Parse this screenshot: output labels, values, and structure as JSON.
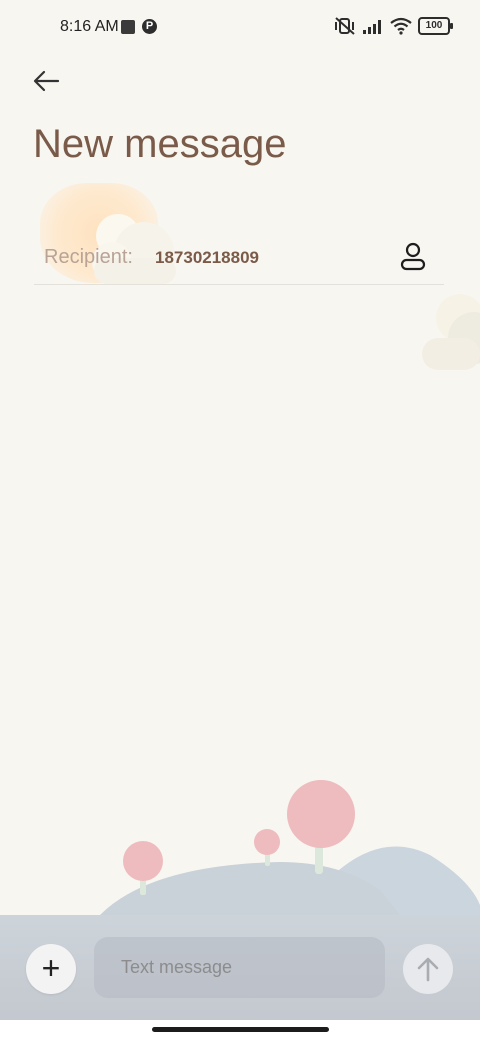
{
  "status_bar": {
    "time": "8:16 AM",
    "app_badge": "P",
    "battery": "100",
    "icons": [
      "app-square-icon",
      "app-p-icon",
      "vibrate-off-icon",
      "signal-icon",
      "wifi-icon",
      "battery-icon"
    ]
  },
  "header": {
    "back_icon": "back-arrow-icon",
    "title": "New message"
  },
  "recipient": {
    "label": "Recipient:",
    "value": "18730218809",
    "contact_icon": "contact-person-icon"
  },
  "composer": {
    "add_icon": "plus-icon",
    "add_symbol": "+",
    "placeholder": "Text message",
    "send_icon": "send-arrow-up-icon"
  },
  "colors": {
    "background": "#f8f6f1",
    "title": "#7a5a49",
    "recipient_label": "#b8a396",
    "recipient_value": "#7b5a48",
    "tree_pink": "#eebbbe",
    "hill": "#cad3db"
  }
}
